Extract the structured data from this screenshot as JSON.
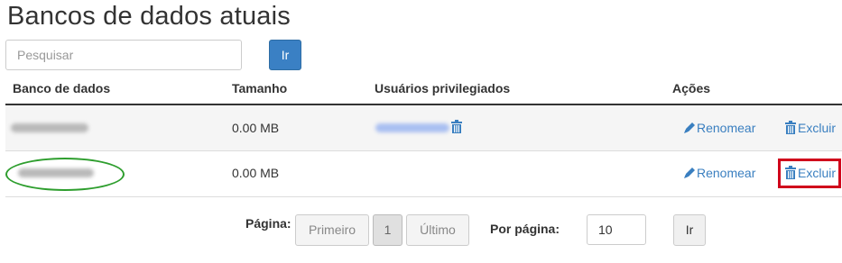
{
  "page": {
    "title": "Bancos de dados atuais"
  },
  "search": {
    "placeholder": "Pesquisar",
    "button_label": "Ir"
  },
  "table": {
    "headers": [
      "Banco de dados",
      "Tamanho",
      "Usuários privilegiados",
      "Ações"
    ],
    "rows": [
      {
        "size": "0.00 MB",
        "rename_label": "Renomear",
        "delete_label": "Excluir"
      },
      {
        "size": "0.00 MB",
        "rename_label": "Renomear",
        "delete_label": "Excluir"
      }
    ]
  },
  "pagination": {
    "label": "Página:",
    "first_label": "Primeiro",
    "current_page": "1",
    "last_label": "Último",
    "per_page_label": "Por página:",
    "per_page_value": "10",
    "go_label": "Ir"
  },
  "icons": {
    "rename": "pencil-icon",
    "delete": "trash-icon"
  },
  "colors": {
    "primary_button": "#3a80c4",
    "link": "#3a7fc0",
    "highlight_box": "#d0021b",
    "annotation_ellipse": "#2e9e2e"
  }
}
